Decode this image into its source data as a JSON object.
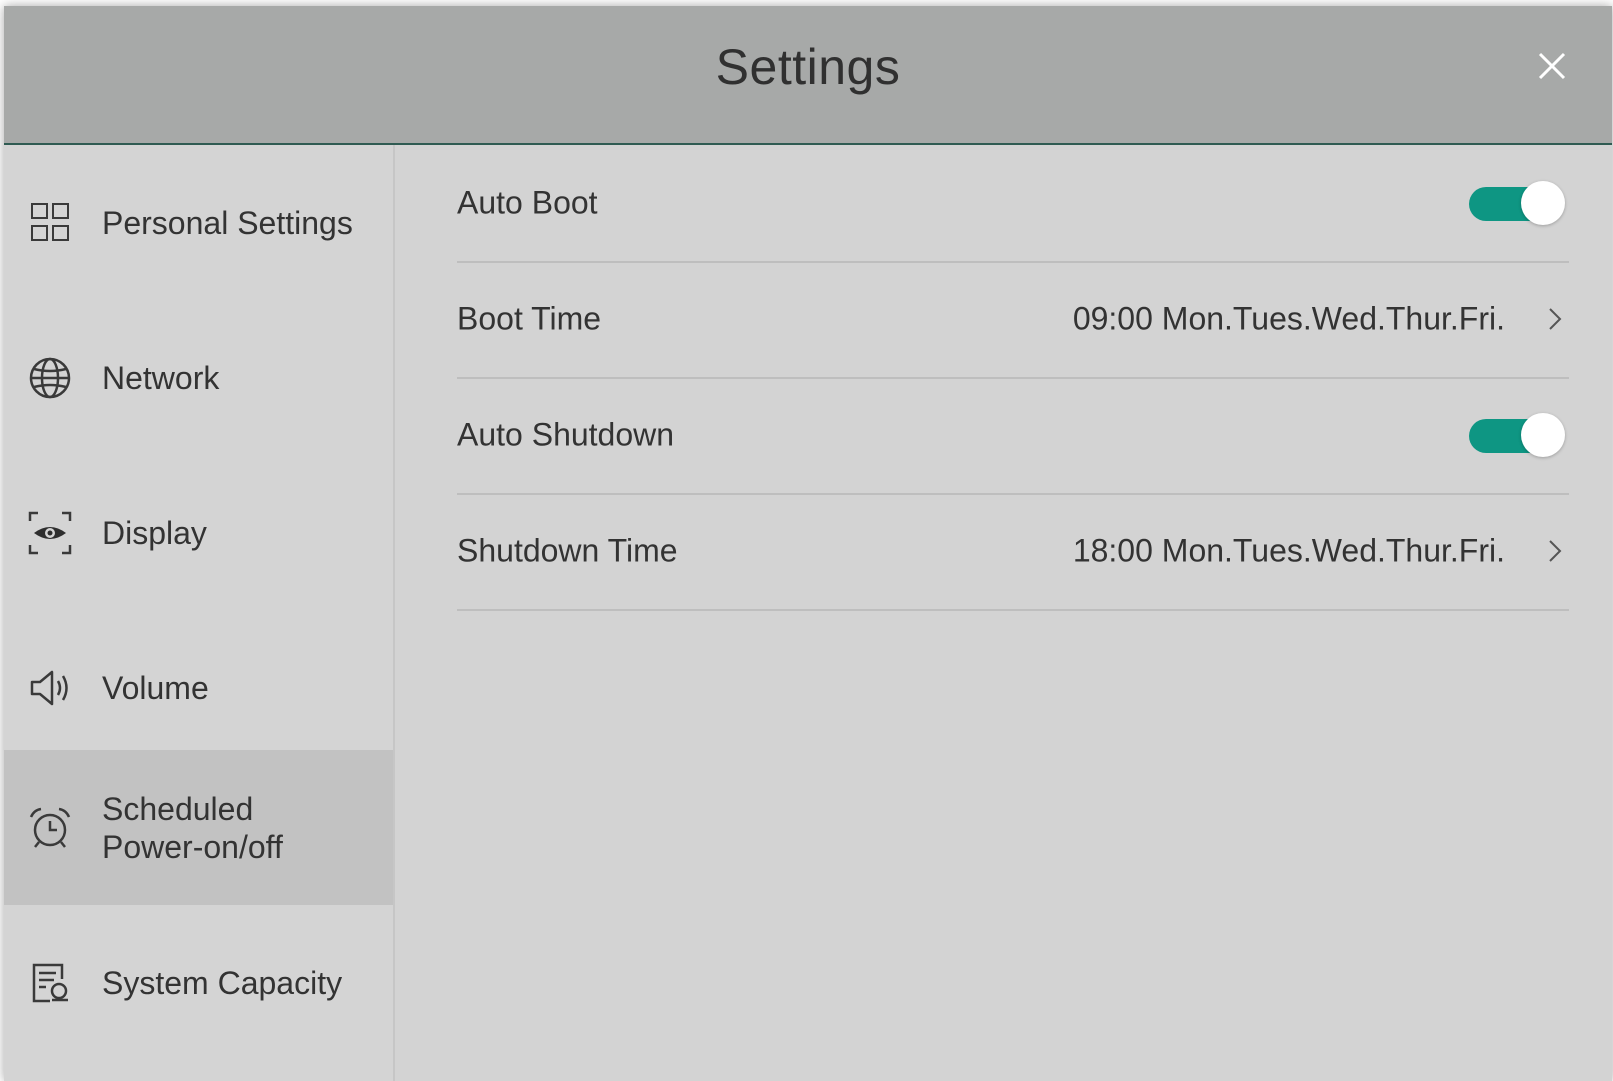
{
  "window": {
    "title": "Settings"
  },
  "sidebar": {
    "items": [
      {
        "label": "Personal Settings",
        "icon": "grid-icon",
        "active": false
      },
      {
        "label": "Network",
        "icon": "globe-icon",
        "active": false
      },
      {
        "label": "Display",
        "icon": "eye-icon",
        "active": false
      },
      {
        "label": "Volume",
        "icon": "speaker-icon",
        "active": false
      },
      {
        "label": "Scheduled Power-on/off",
        "icon": "alarm-clock-icon",
        "active": true
      },
      {
        "label": "System Capacity",
        "icon": "storage-icon",
        "active": false
      }
    ]
  },
  "settings": {
    "auto_boot": {
      "label": "Auto Boot",
      "enabled": true
    },
    "boot_time": {
      "label": "Boot Time",
      "value": "09:00 Mon.Tues.Wed.Thur.Fri."
    },
    "auto_shutdown": {
      "label": "Auto Shutdown",
      "enabled": true
    },
    "shutdown_time": {
      "label": "Shutdown Time",
      "value": "18:00 Mon.Tues.Wed.Thur.Fri."
    }
  },
  "colors": {
    "accent": "#0e9683",
    "titlebar": "#a7a9a8",
    "background": "#d3d3d3",
    "active_item": "#c2c2c2"
  }
}
